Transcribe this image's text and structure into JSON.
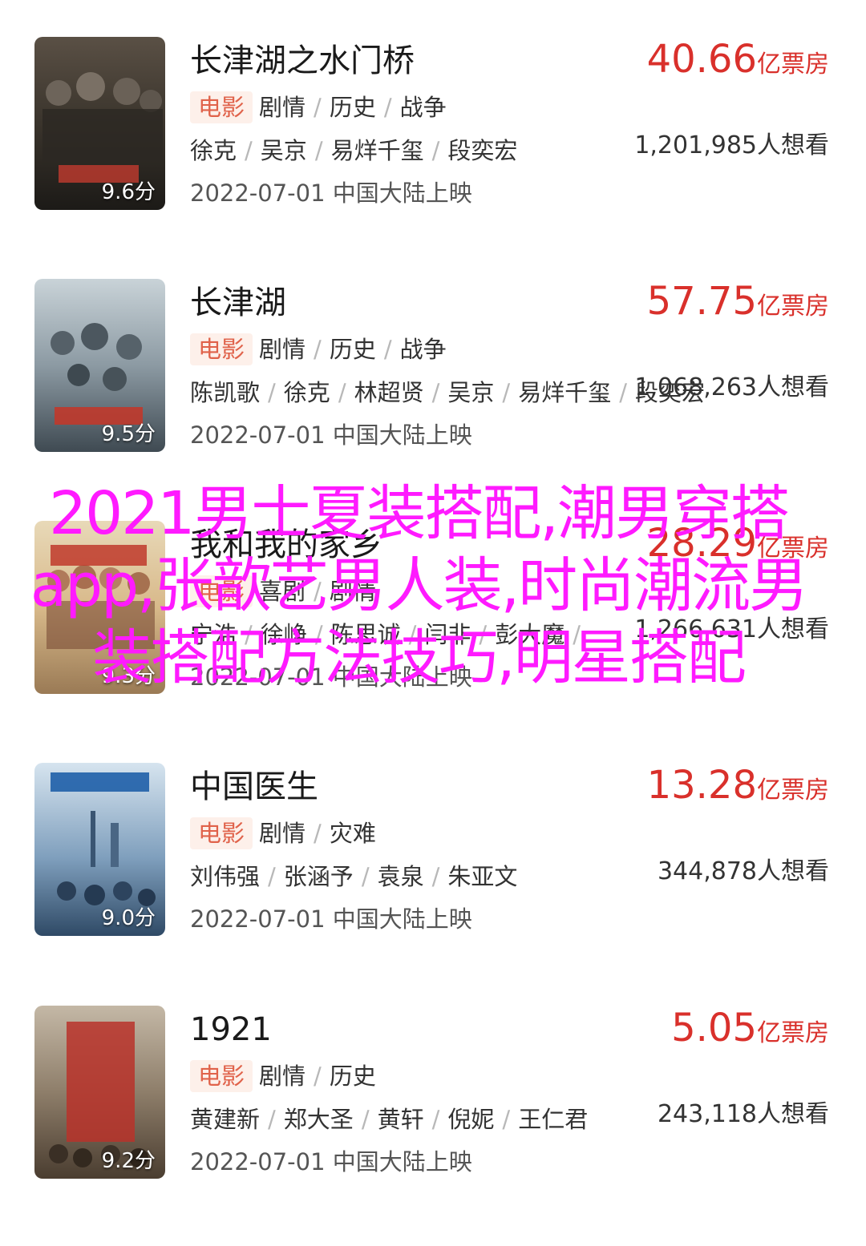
{
  "movies": [
    {
      "title": "长津湖之水门桥",
      "score": "9.6分",
      "box_office_value": "40.66",
      "box_office_unit": "亿票房",
      "tag": "电影",
      "genres": [
        "剧情",
        "历史",
        "战争"
      ],
      "want_count": "1,201,985人想看",
      "cast": [
        "徐克",
        "吴京",
        "易烊千玺",
        "段奕宏"
      ],
      "release": "2022-07-01 中国大陆上映"
    },
    {
      "title": "长津湖",
      "score": "9.5分",
      "box_office_value": "57.75",
      "box_office_unit": "亿票房",
      "tag": "电影",
      "genres": [
        "剧情",
        "历史",
        "战争"
      ],
      "want_count": "1,068,263人想看",
      "cast": [
        "陈凯歌",
        "徐克",
        "林超贤",
        "吴京",
        "易烊千玺",
        "段奕宏"
      ],
      "release": "2022-07-01 中国大陆上映"
    },
    {
      "title": "我和我的家乡",
      "score": "9.3分",
      "box_office_value": "28.29",
      "box_office_unit": "亿票房",
      "tag": "电影",
      "genres": [
        "喜剧",
        "剧情"
      ],
      "want_count": "1,266,631人想看",
      "cast": [
        "宁浩",
        "徐峥",
        "陈思诚",
        "闫非",
        "彭大魔",
        "..."
      ],
      "release": "2022-07-01 中国大陆上映"
    },
    {
      "title": "中国医生",
      "score": "9.0分",
      "box_office_value": "13.28",
      "box_office_unit": "亿票房",
      "tag": "电影",
      "genres": [
        "剧情",
        "灾难"
      ],
      "want_count": "344,878人想看",
      "cast": [
        "刘伟强",
        "张涵予",
        "袁泉",
        "朱亚文"
      ],
      "release": "2022-07-01 中国大陆上映"
    },
    {
      "title": "1921",
      "score": "9.2分",
      "box_office_value": "5.05",
      "box_office_unit": "亿票房",
      "tag": "电影",
      "genres": [
        "剧情",
        "历史"
      ],
      "want_count": "243,118人想看",
      "cast": [
        "黄建新",
        "郑大圣",
        "黄轩",
        "倪妮",
        "王仁君"
      ],
      "release": "2022-07-01 中国大陆上映"
    }
  ],
  "overlay": {
    "text": "2021男士夏装搭配,潮男穿搭app,张歆艺男人装,时尚潮流男装搭配方法技巧,明星搭配"
  },
  "colors": {
    "box_office": "#d9302b",
    "tag_bg": "#fdf0ea",
    "tag_text": "#e0624a",
    "overlay": "#ff1aff"
  }
}
